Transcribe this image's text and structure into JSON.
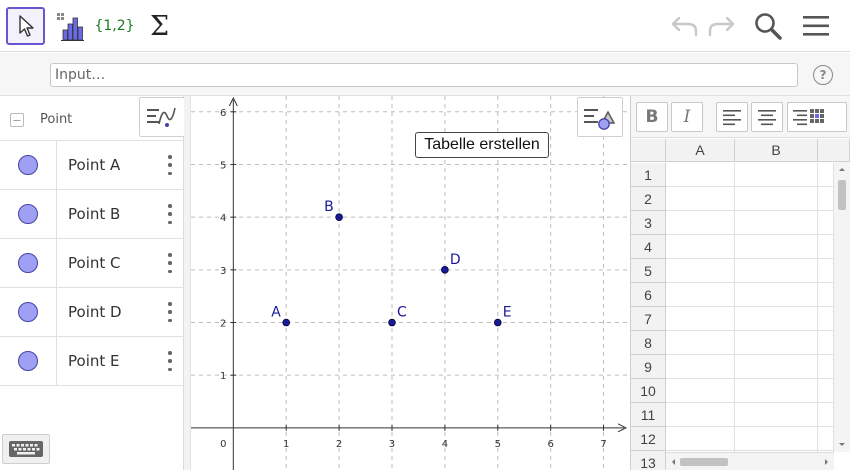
{
  "toolbar": {
    "tools": [
      {
        "name": "move-tool",
        "icon": "cursor-arrow-icon"
      },
      {
        "name": "graphics-tool",
        "icon": "bar-chart-icon"
      },
      {
        "name": "list-tool",
        "label": "{1,2}"
      },
      {
        "name": "sum-tool",
        "label": "Σ"
      }
    ],
    "right_icons": [
      "undo-icon",
      "redo-icon",
      "search-icon",
      "menu-icon"
    ]
  },
  "input": {
    "placeholder": "Input…"
  },
  "algebra": {
    "group_label": "Point",
    "items": [
      {
        "label": "Point A"
      },
      {
        "label": "Point B"
      },
      {
        "label": "Point C"
      },
      {
        "label": "Point D"
      },
      {
        "label": "Point E"
      }
    ]
  },
  "graphics": {
    "table_button_label": "Tabelle erstellen",
    "x_ticks": [
      "0",
      "1",
      "2",
      "3",
      "4",
      "5",
      "6",
      "7"
    ],
    "y_ticks": [
      "1",
      "2",
      "3",
      "4",
      "5",
      "6"
    ],
    "x_range": [
      -0.8,
      7.5
    ],
    "y_range": [
      -0.8,
      6.3
    ],
    "points": [
      {
        "name": "A",
        "x": 1,
        "y": 2
      },
      {
        "name": "B",
        "x": 2,
        "y": 4
      },
      {
        "name": "C",
        "x": 3,
        "y": 2
      },
      {
        "name": "D",
        "x": 4,
        "y": 3
      },
      {
        "name": "E",
        "x": 5,
        "y": 2
      }
    ],
    "point_color": "#1a1a99"
  },
  "spreadsheet": {
    "tools": [
      "B",
      "I"
    ],
    "columns": [
      "A",
      "B"
    ],
    "rows": [
      "1",
      "2",
      "3",
      "4",
      "5",
      "6",
      "7",
      "8",
      "9",
      "10",
      "11",
      "12",
      "13"
    ]
  },
  "colors": {
    "accent": "#6557d2",
    "marble_fill": "#9f9ff3",
    "marble_stroke": "#4343a8"
  }
}
